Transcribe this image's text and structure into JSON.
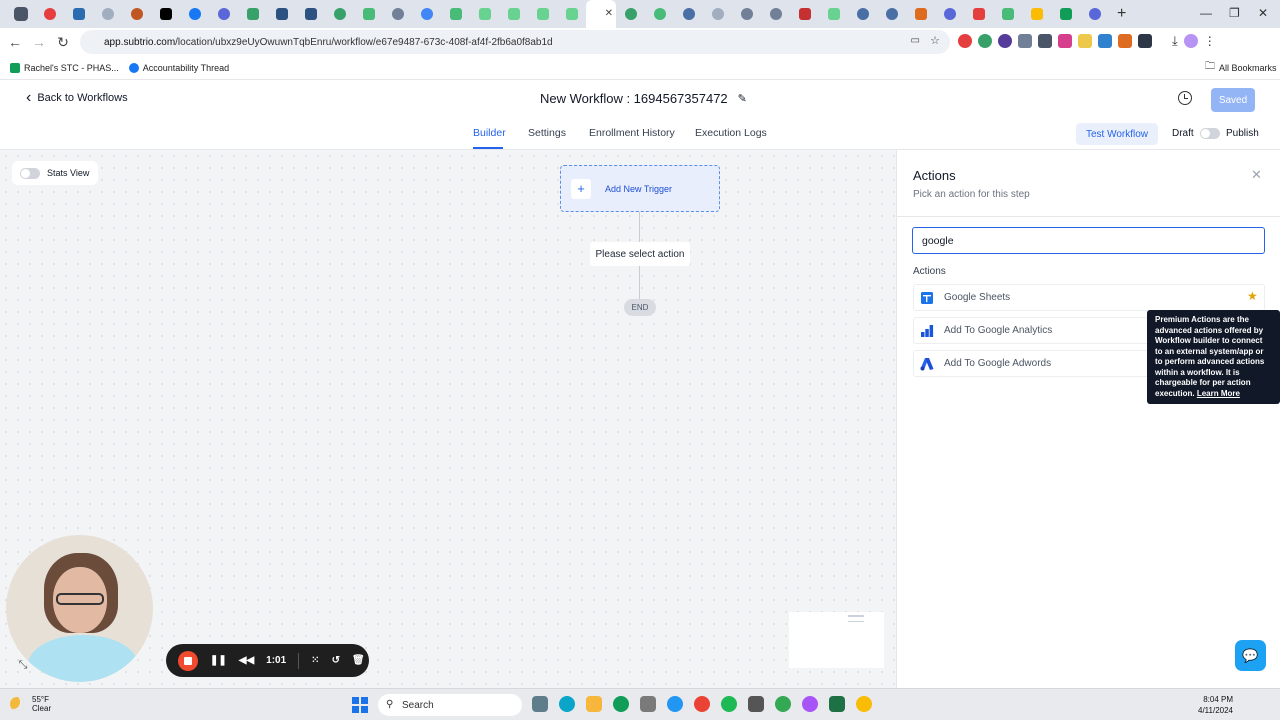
{
  "browser": {
    "url_host": "app.subtrio.com",
    "url_path": "/location/ubxz9eUyOwuwnTqbEnru/workflow/e67e9487-673c-408f-af4f-2fb6a0f8ab1d",
    "bookmarks": [
      "Rachel's STC - PHAS...",
      "Accountability Thread"
    ],
    "all_bookmarks": "All Bookmarks"
  },
  "header": {
    "back_label": "Back to Workflows",
    "workflow_title": "New Workflow : 1694567357472",
    "saved_label": "Saved"
  },
  "tabs": [
    "Builder",
    "Settings",
    "Enrollment History",
    "Execution Logs"
  ],
  "toolbar": {
    "test_label": "Test Workflow",
    "draft_label": "Draft",
    "publish_label": "Publish"
  },
  "canvas": {
    "stats_label": "Stats View",
    "add_trigger_label": "Add New Trigger",
    "select_action_label": "Please select action",
    "end_label": "END"
  },
  "panel": {
    "title": "Actions",
    "subtitle": "Pick an action for this step",
    "search_value": "google",
    "section_label": "Actions",
    "items": [
      {
        "label": "Google Sheets",
        "icon": "google-sheets-icon",
        "color": "#1a73e8"
      },
      {
        "label": "Add To Google Analytics",
        "icon": "google-analytics-icon",
        "color": "#1a56db"
      },
      {
        "label": "Add To Google Adwords",
        "icon": "google-adwords-icon",
        "color": "#1d4ed8"
      }
    ],
    "tooltip_text": "Premium Actions are the advanced actions offered by Workflow builder to connect to an external system/app or to perform advanced actions within a workflow. It is chargeable for per action execution.",
    "tooltip_link": "Learn More"
  },
  "recorder": {
    "time": "1:01"
  },
  "taskbar": {
    "temp": "55°F",
    "condition": "Clear",
    "search_label": "Search",
    "time": "8:04 PM",
    "date": "4/11/2024"
  },
  "colors": {
    "accent": "#2563eb",
    "saved_button": "#93b4f5",
    "premium_star": "#e0a408"
  }
}
